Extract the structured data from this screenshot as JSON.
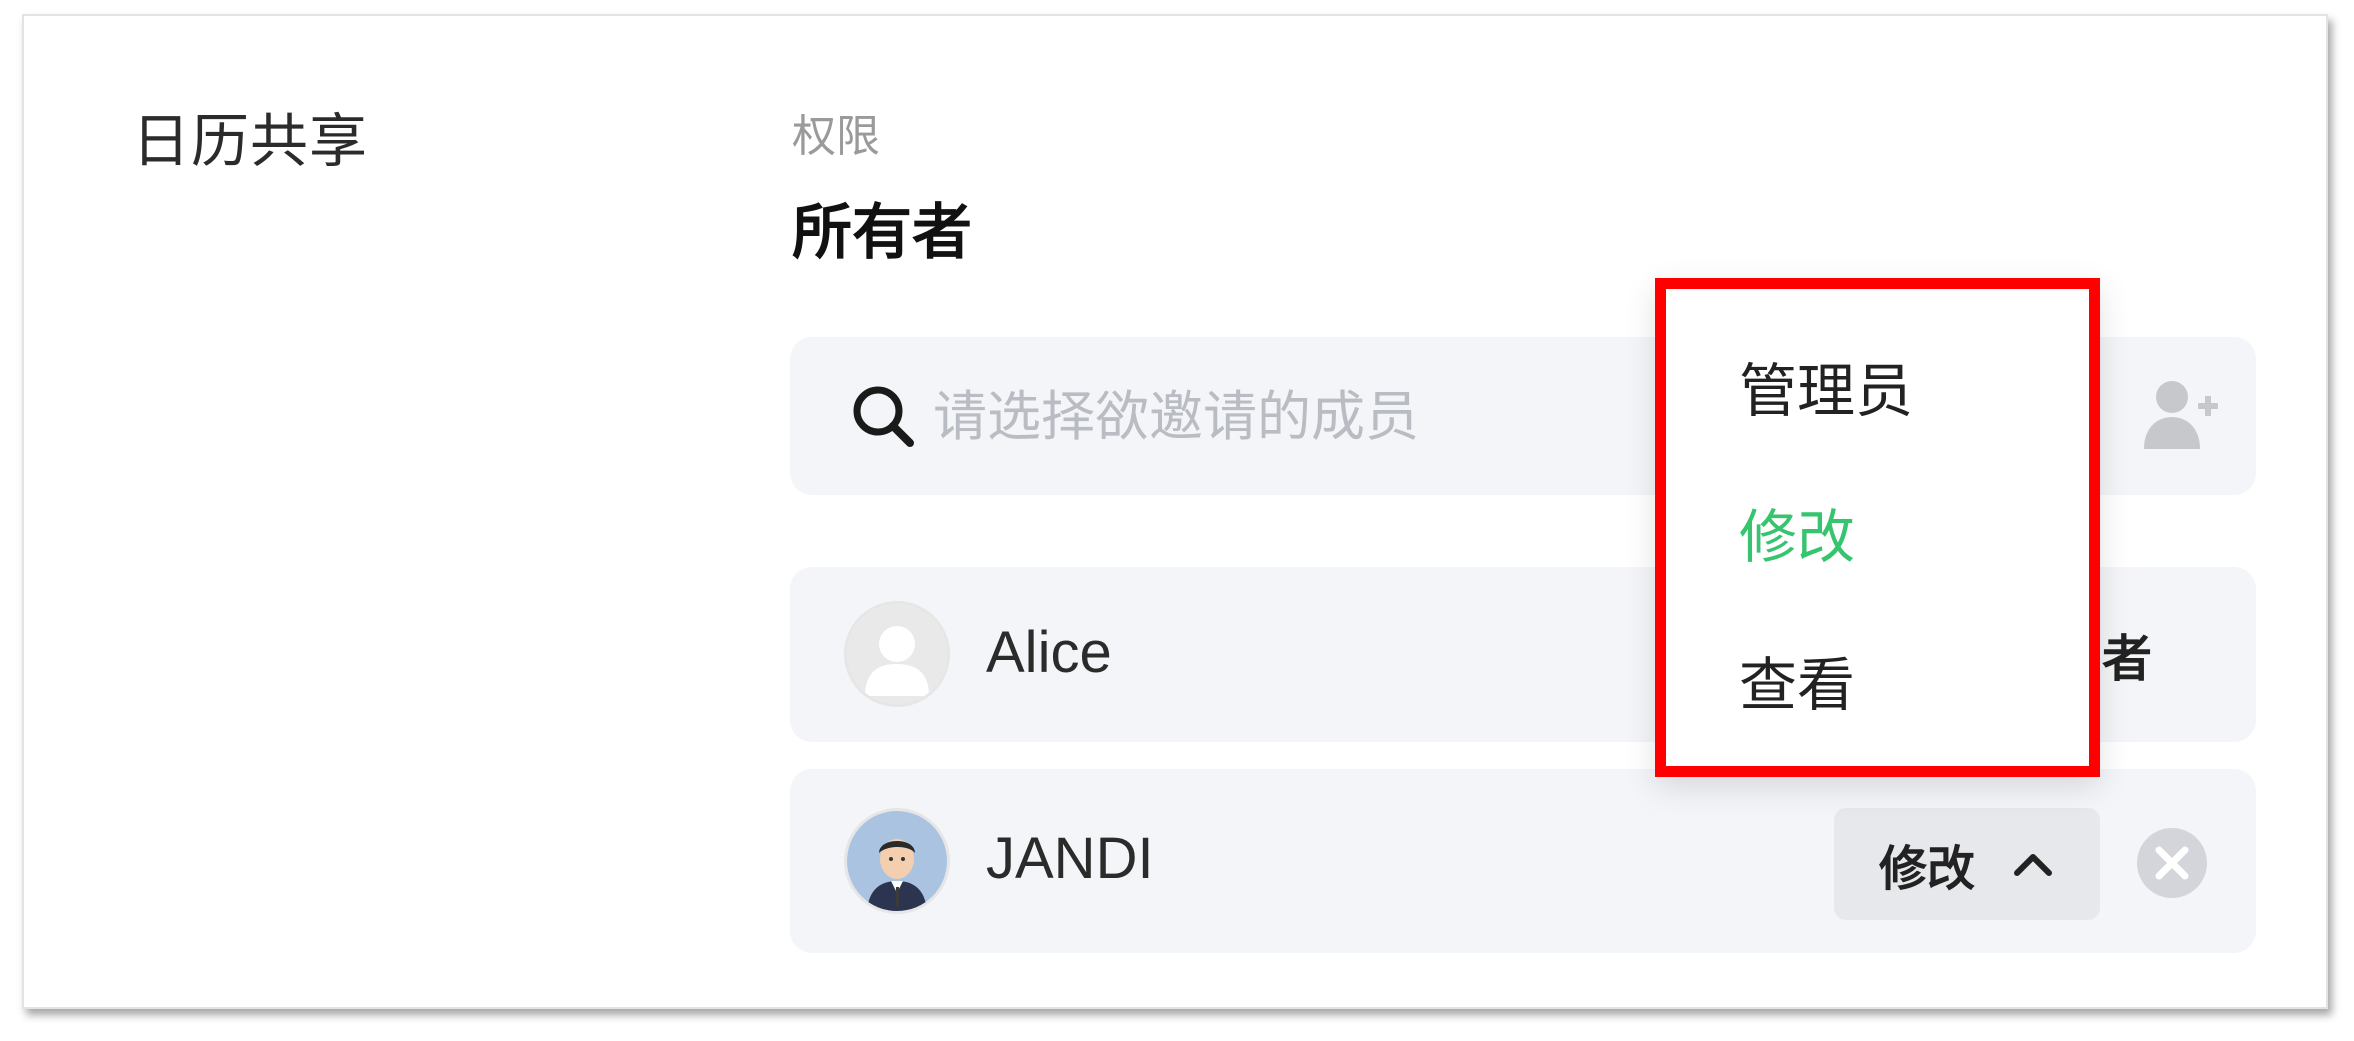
{
  "section": {
    "label": "日历共享"
  },
  "permission": {
    "caption": "权限",
    "value": "所有者"
  },
  "search": {
    "placeholder": "请选择欲邀请的成员",
    "icon": "search-icon",
    "invite_icon": "add-user-icon"
  },
  "members": [
    {
      "name": "Alice",
      "role": "所有者",
      "avatar": "default-user-avatar"
    },
    {
      "name": "JANDI",
      "role": "修改",
      "avatar": "jandi-avatar",
      "role_selector_icon": "chevron-up-icon",
      "remove_icon": "close-circle-icon"
    }
  ],
  "role_dropdown": {
    "options": [
      {
        "label": "管理员",
        "selected": false
      },
      {
        "label": "修改",
        "selected": true
      },
      {
        "label": "查看",
        "selected": false
      }
    ],
    "highlight_color": "#ff0000"
  },
  "colors": {
    "accent_selected": "#36c46e",
    "panel_bg": "#f4f5f8",
    "select_bg": "#e7e8eb"
  }
}
